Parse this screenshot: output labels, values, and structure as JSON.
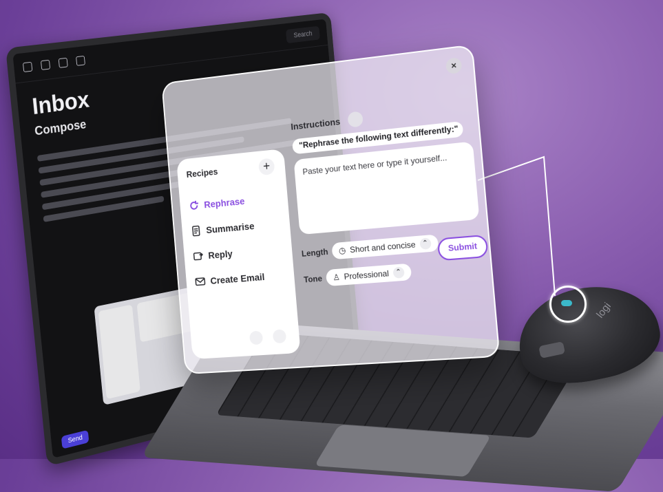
{
  "laptop": {
    "inbox_title": "Inbox",
    "compose_title": "Compose",
    "search_placeholder": "Search",
    "send_label": "Send"
  },
  "panel": {
    "close_label": "×",
    "instructions_label": "Instructions",
    "instruction_text": "\"Rephrase the following text differently:\"",
    "text_placeholder": "Paste your text here or type it yourself...",
    "recipes_title": "Recipes",
    "add_label": "+",
    "recipes": [
      {
        "label": "Rephrase",
        "icon": "refresh-icon",
        "active": true
      },
      {
        "label": "Summarise",
        "icon": "document-icon",
        "active": false
      },
      {
        "label": "Reply",
        "icon": "reply-icon",
        "active": false
      },
      {
        "label": "Create Email",
        "icon": "envelope-icon",
        "active": false
      }
    ],
    "length_label": "Length",
    "length_value": "Short and concise",
    "tone_label": "Tone",
    "tone_value": "Professional",
    "submit_label": "Submit"
  },
  "mouse": {
    "brand": "logi"
  },
  "colors": {
    "accent": "#8a4fe0",
    "background": "#7a4fa8",
    "gesture_button": "#3bb8c9"
  }
}
